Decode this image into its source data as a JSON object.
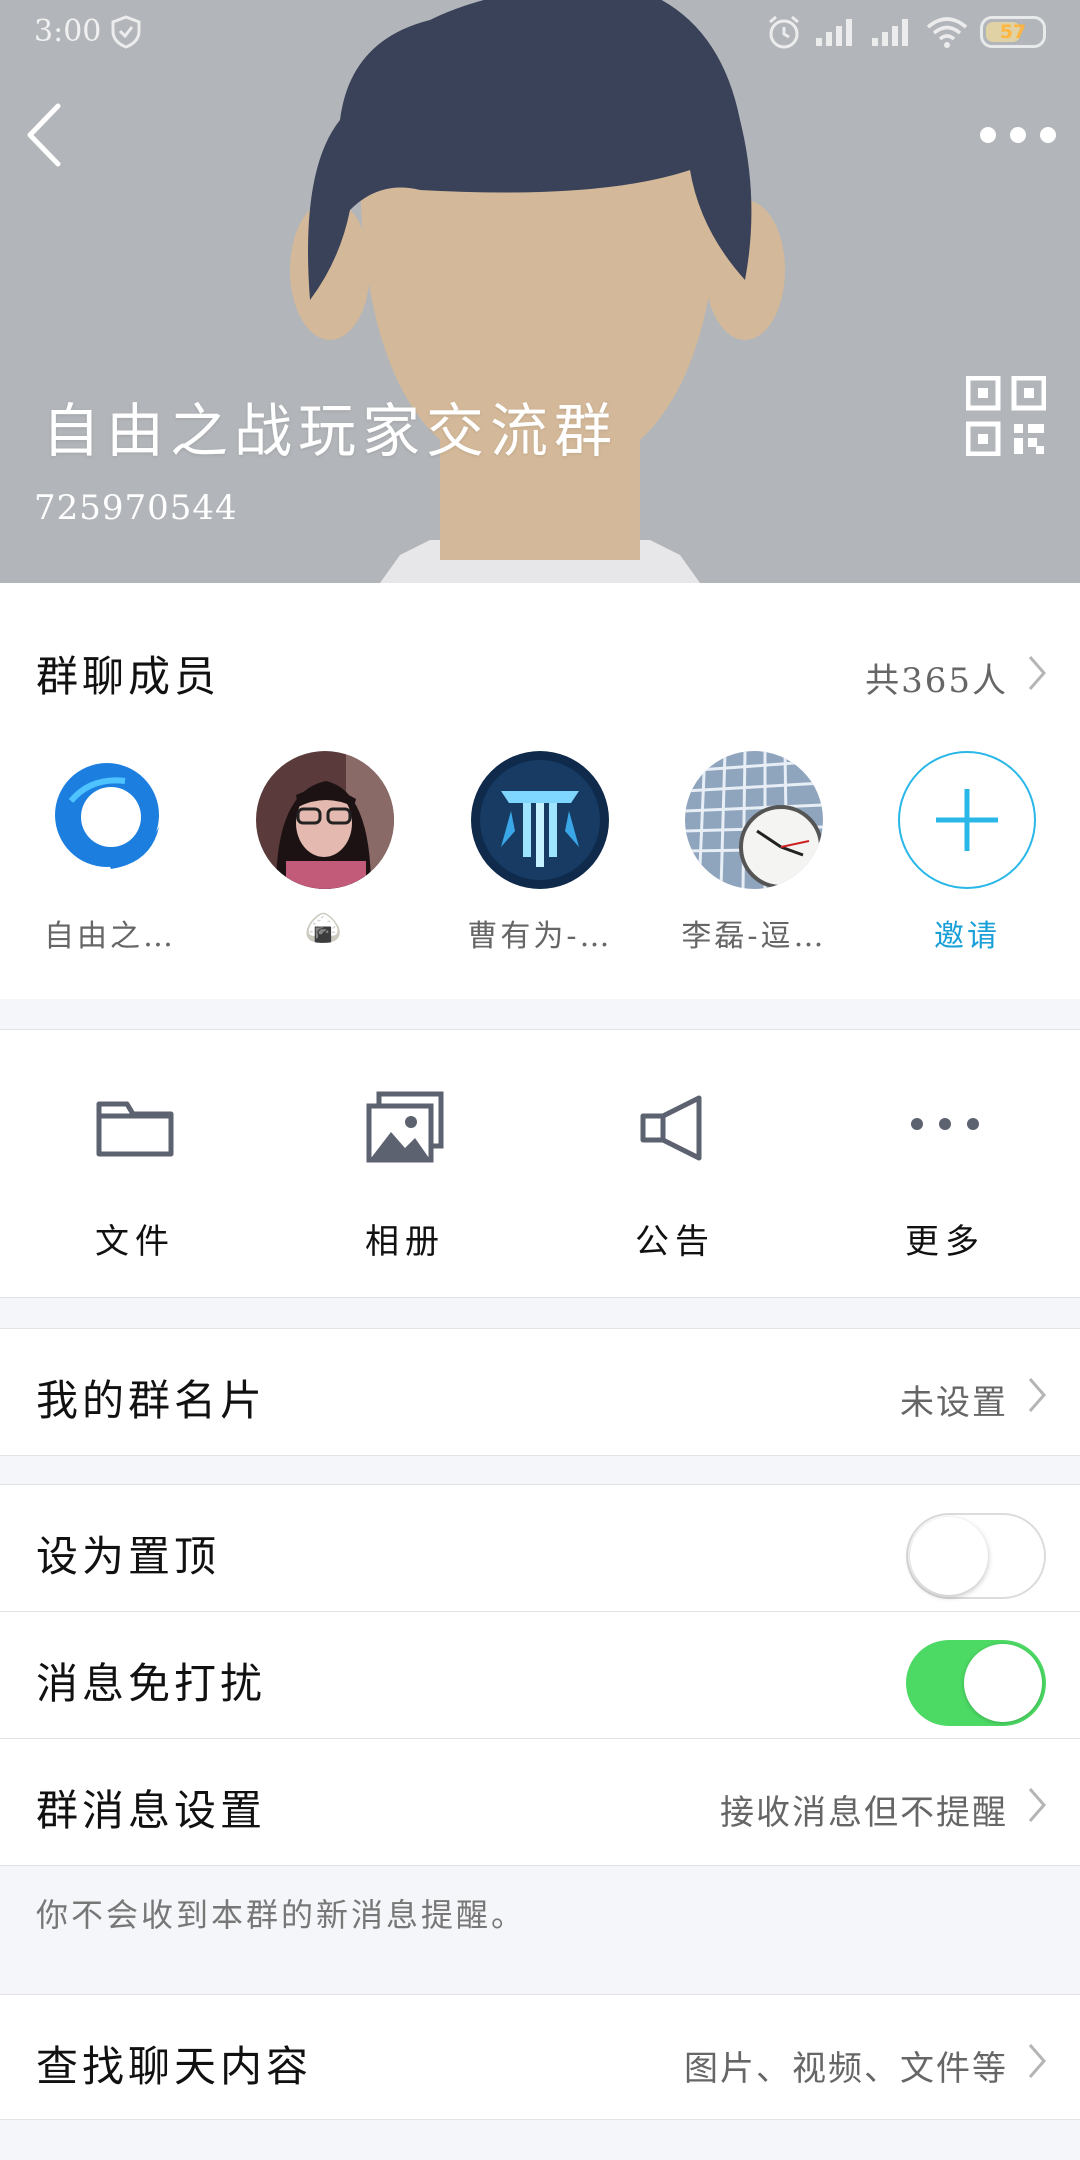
{
  "status_bar": {
    "time": "3:00",
    "battery": "57"
  },
  "header": {
    "group_name": "自由之战玩家交流群",
    "group_id": "725970544"
  },
  "members": {
    "title": "群聊成员",
    "count_label": "共365人",
    "list": [
      {
        "name": "自由之…"
      },
      {
        "name": "🍙"
      },
      {
        "name": "曹有为-…"
      },
      {
        "name": "李磊-逗…"
      }
    ],
    "invite_label": "邀请"
  },
  "tools": [
    {
      "label": "文件",
      "icon": "folder-icon"
    },
    {
      "label": "相册",
      "icon": "photo-album-icon"
    },
    {
      "label": "公告",
      "icon": "megaphone-icon"
    },
    {
      "label": "更多",
      "icon": "more-dots-icon"
    }
  ],
  "my_card": {
    "label": "我的群名片",
    "value": "未设置"
  },
  "pin_top": {
    "label": "设为置顶",
    "enabled": false
  },
  "do_not_disturb": {
    "label": "消息免打扰",
    "enabled": true
  },
  "message_settings": {
    "label": "群消息设置",
    "value": "接收消息但不提醒"
  },
  "hint_text": "你不会收到本群的新消息提醒。",
  "search_chat": {
    "label": "查找聊天内容",
    "value": "图片、视频、文件等"
  },
  "colors": {
    "accent": "#1aa0d8",
    "toggle_on": "#4cd964",
    "header_bg": "#b2b5b9"
  }
}
